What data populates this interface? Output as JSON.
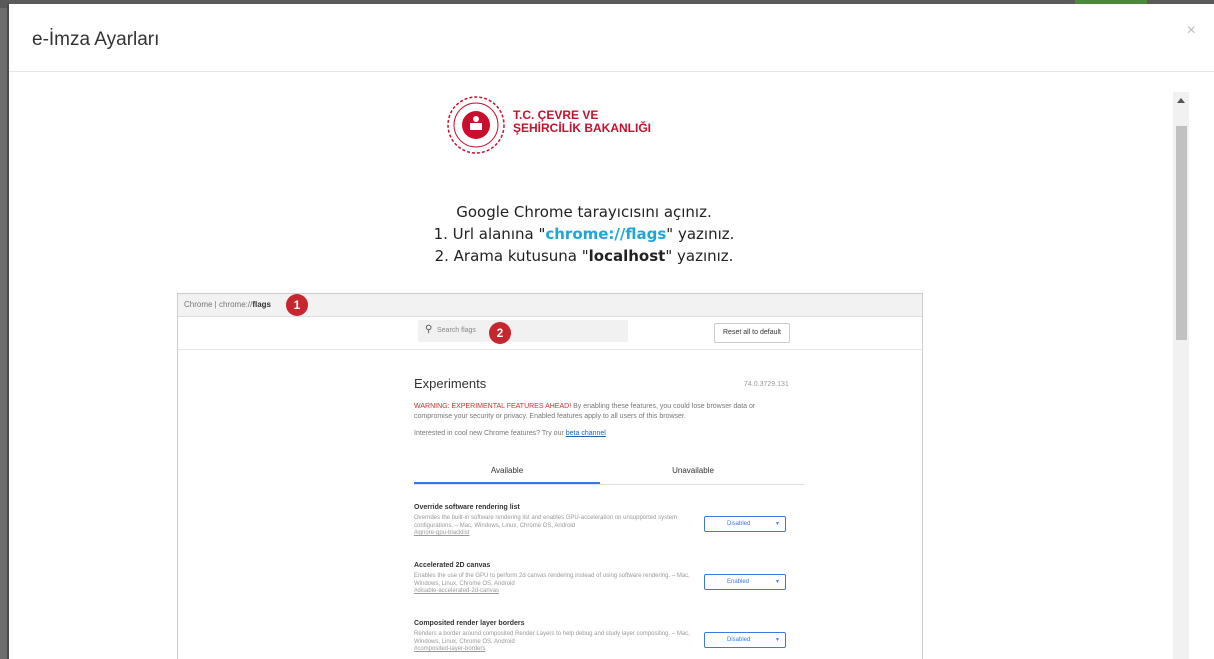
{
  "modal": {
    "title": "e-İmza Ayarları",
    "close_glyph": "×"
  },
  "logo": {
    "line1": "T.C. ÇEVRE VE",
    "line2": "ŞEHİRCİLİK BAKANLIĞI"
  },
  "instructions": {
    "line1": "Google Chrome tarayıcısını açınız.",
    "line2_pre": "1. Url alanına \"",
    "line2_hl": "chrome://flags",
    "line2_post": "\" yazınız.",
    "line3_pre": "2. Arama kutusuna \"",
    "line3_b": "localhost",
    "line3_post": "\" yazınız."
  },
  "screenshot": {
    "address_prefix": "Chrome | chrome://",
    "address_bold": "flags",
    "badge1": "1",
    "badge2": "2",
    "search_placeholder": "Search flags",
    "reset_label": "Reset all to default",
    "experiments_title": "Experiments",
    "version": "74.0.3729.131",
    "warning_red": "WARNING: EXPERIMENTAL FEATURES AHEAD!",
    "warning_rest": " By enabling these features, you could lose browser data or compromise your security or privacy. Enabled features apply to all users of this browser.",
    "cool_text": "Interested in cool new Chrome features? Try our ",
    "cool_link": "beta channel",
    "tab_available": "Available",
    "tab_unavailable": "Unavailable",
    "flags": [
      {
        "title": "Override software rendering list",
        "desc": "Overrides the built-in software rendering list and enables GPU-acceleration on unsupported system configurations. – Mac, Windows, Linux, Chrome OS, Android",
        "link": "#ignore-gpu-blacklist",
        "value": "Disabled"
      },
      {
        "title": "Accelerated 2D canvas",
        "desc": "Enables the use of the GPU to perform 2d canvas rendering instead of using software rendering. – Mac, Windows, Linux, Chrome OS, Android",
        "link": "#disable-accelerated-2d-canvas",
        "value": "Enabled"
      },
      {
        "title": "Composited render layer borders",
        "desc": "Renders a border around composited Render Layers to help debug and study layer compositing. – Mac, Windows, Linux, Chrome OS, Android",
        "link": "#composited-layer-borders",
        "value": "Disabled"
      }
    ]
  }
}
